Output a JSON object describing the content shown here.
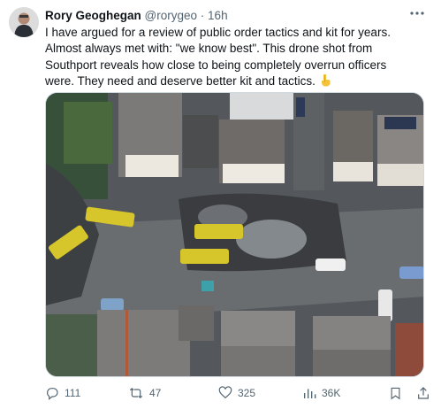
{
  "tweet": {
    "author_name": "Rory Geoghegan",
    "author_handle": "@rorygeo",
    "separator": "·",
    "timestamp": "16h",
    "text": "I have argued for a review of public order tactics and kit for years. Almost always met with: \"we know best\". This drone shot from Southport reveals how close to being completely overrun officers were. They need and deserve better kit and tactics.",
    "emoji": "👇"
  },
  "actions": {
    "replies": "111",
    "reposts": "47",
    "likes": "325",
    "views": "36K"
  },
  "icons": {
    "more": "more-horizontal-icon",
    "reply": "reply-icon",
    "repost": "repost-icon",
    "like": "heart-icon",
    "views": "views-chart-icon",
    "bookmark": "bookmark-icon",
    "share": "share-icon"
  },
  "colors": {
    "text_primary": "#0f1419",
    "text_secondary": "#536471",
    "border": "#cfd9de"
  }
}
